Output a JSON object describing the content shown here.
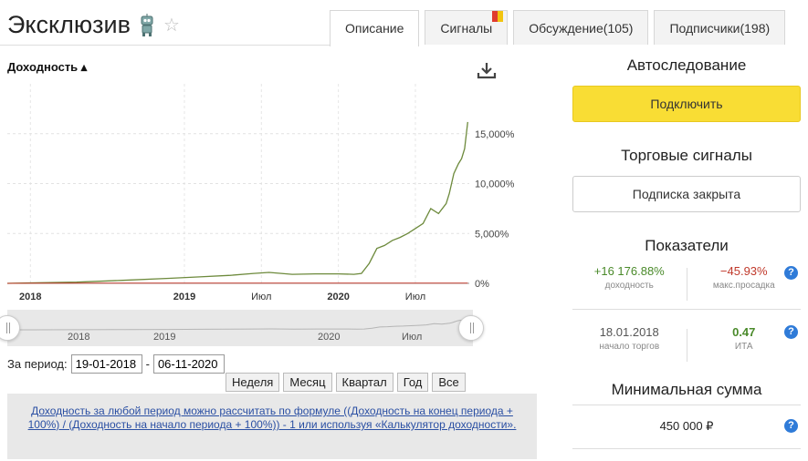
{
  "header": {
    "title": "Эксклюзив",
    "robot_icon": "robot-icon",
    "favorite_icon": "star-icon"
  },
  "tabs": [
    {
      "label": "Описание",
      "active": true
    },
    {
      "label": "Сигналы",
      "active": false
    },
    {
      "label": "Обсуждение(105)",
      "active": false
    },
    {
      "label": "Подписчики(198)",
      "active": false
    }
  ],
  "chart_section": {
    "label": "Доходность ▴",
    "download_icon": "download-icon"
  },
  "chart_data": {
    "type": "line",
    "x_labels": [
      "2018",
      "2019",
      "Июл",
      "2020",
      "Июл"
    ],
    "y_tick_labels": [
      "0%",
      "5,000%",
      "10,000%",
      "15,000%"
    ],
    "yticks": [
      0,
      5000,
      10000,
      15000
    ],
    "ylim": [
      0,
      20000
    ],
    "xlim": [
      2017.85,
      2020.85
    ],
    "series": [
      {
        "color": "#6d8a3c",
        "x": [
          2017.85,
          2018.0,
          2018.3,
          2018.6,
          2018.9,
          2019.1,
          2019.3,
          2019.45,
          2019.55,
          2019.7,
          2019.85,
          2020.0,
          2020.1,
          2020.15,
          2020.2,
          2020.25,
          2020.3,
          2020.35,
          2020.4,
          2020.45,
          2020.5,
          2020.55,
          2020.6,
          2020.65,
          2020.7,
          2020.72,
          2020.75,
          2020.78,
          2020.8,
          2020.82,
          2020.84
        ],
        "y": [
          0,
          50,
          120,
          300,
          500,
          650,
          800,
          1000,
          1100,
          900,
          950,
          950,
          900,
          1000,
          2000,
          3500,
          3800,
          4300,
          4600,
          5000,
          5500,
          6000,
          7500,
          7000,
          8000,
          9000,
          11000,
          12000,
          12500,
          13500,
          16177
        ]
      },
      {
        "color": "#c0392b",
        "x": [
          2017.85,
          2018.0,
          2018.3,
          2018.6,
          2018.9,
          2019.1,
          2019.3,
          2019.55,
          2019.85,
          2020.1,
          2020.3,
          2020.5,
          2020.7,
          2020.84
        ],
        "y": [
          0,
          10,
          20,
          30,
          30,
          30,
          30,
          30,
          30,
          30,
          30,
          30,
          30,
          30
        ]
      }
    ]
  },
  "navigator": {
    "labels": [
      "2018",
      "2019",
      "2020",
      "Июл"
    ]
  },
  "period": {
    "label": "За период:",
    "from": "19-01-2018",
    "separator": "-",
    "to": "06-11-2020"
  },
  "range_buttons": [
    "Неделя",
    "Месяц",
    "Квартал",
    "Год",
    "Все"
  ],
  "info": {
    "text": "Доходность за любой период можно рассчитать по формуле ((Доходность на конец периода + 100%) / (Доходность на начало периода + 100%)) - 1 или используя «Калькулятор доходности»."
  },
  "sidebar": {
    "autofollow": {
      "heading": "Автоследование",
      "button": "Подключить"
    },
    "signals": {
      "heading": "Торговые сигналы",
      "button": "Подписка закрыта"
    },
    "indicators": {
      "heading": "Показатели",
      "row1": {
        "left_value": "+16 176.88%",
        "left_caption": "доходность",
        "right_value": "−45.93%",
        "right_caption": "макс.просадка"
      },
      "row2": {
        "left_value": "18.01.2018",
        "left_caption": "начало торгов",
        "right_value": "0.47",
        "right_caption": "ИТА"
      }
    },
    "min_sum": {
      "heading": "Минимальная сумма",
      "value": "450 000 ₽"
    },
    "help_glyph": "?",
    "colors": {
      "positive": "#4a8a2a",
      "negative": "#c0392b",
      "accent": "#f9dd34",
      "help": "#2f7bd8"
    }
  }
}
